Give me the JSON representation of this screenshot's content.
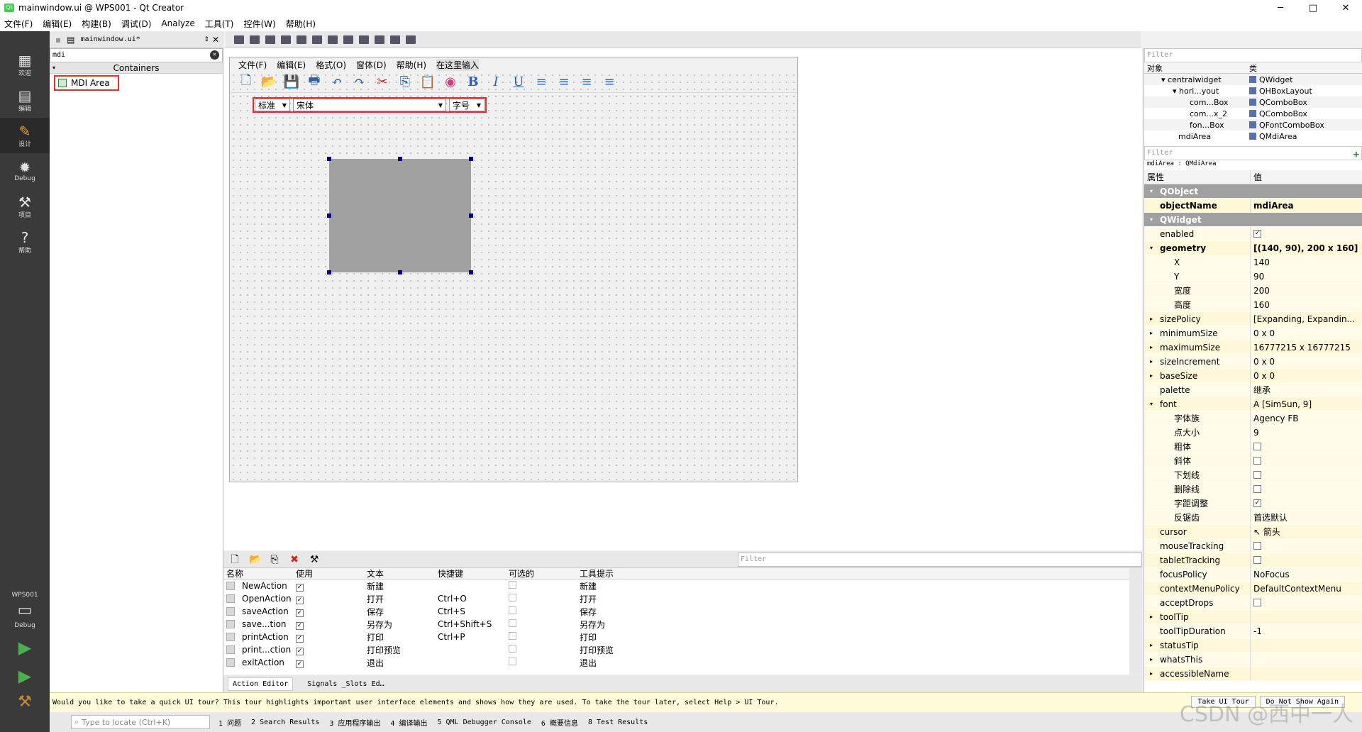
{
  "window": {
    "title": "mainwindow.ui @ WPS001 - Qt Creator",
    "icon": "qt-logo",
    "buttons": [
      "─",
      "□",
      "✕"
    ]
  },
  "menubar": [
    "文件(F)",
    "编辑(E)",
    "构建(B)",
    "调试(D)",
    "Analyze",
    "工具(T)",
    "控件(W)",
    "帮助(H)"
  ],
  "modes": [
    {
      "label": "欢迎",
      "icon": "grid-icon",
      "glyph": "▦"
    },
    {
      "label": "编辑",
      "icon": "edit-doc-icon",
      "glyph": "▤"
    },
    {
      "label": "设计",
      "icon": "pencil-icon",
      "glyph": "✎"
    },
    {
      "label": "Debug",
      "icon": "bug-icon",
      "glyph": "✹"
    },
    {
      "label": "项目",
      "icon": "wrench-icon",
      "glyph": "⚒"
    },
    {
      "label": "帮助",
      "icon": "help-icon",
      "glyph": "?"
    }
  ],
  "kit": {
    "name": "WPS001",
    "config": "Debug"
  },
  "editor": {
    "doc_name": "mainwindow.ui*"
  },
  "widgetbox": {
    "filter": "mdi",
    "category": "Containers",
    "item": "MDI Area"
  },
  "form": {
    "menu": [
      "文件(F)",
      "编辑(E)",
      "格式(O)",
      "窗体(D)",
      "帮助(H)",
      "在这里输入"
    ],
    "toolbar_glyphs": [
      "🗋",
      "📂",
      "💾",
      "🖶",
      "↶",
      "↷",
      "✂",
      "⎘",
      "📋",
      "◉",
      "B",
      "I",
      "U",
      "≡",
      "≡",
      "≡",
      "≡"
    ],
    "combos": [
      "标准",
      "宋体",
      "字号"
    ]
  },
  "actions": {
    "filter_placeholder": "Filter",
    "headers": [
      "名称",
      "使用",
      "文本",
      "快捷键",
      "可选的",
      "工具提示"
    ],
    "rows": [
      {
        "name": "NewAction",
        "used": "✓",
        "text": "新建",
        "shortcut": "",
        "tip": "新建"
      },
      {
        "name": "OpenAction",
        "used": "✓",
        "text": "打开",
        "shortcut": "Ctrl+O",
        "tip": "打开"
      },
      {
        "name": "saveAction",
        "used": "✓",
        "text": "保存",
        "shortcut": "Ctrl+S",
        "tip": "保存"
      },
      {
        "name": "save...tion",
        "used": "✓",
        "text": "另存为",
        "shortcut": "Ctrl+Shift+S",
        "tip": "另存为"
      },
      {
        "name": "printAction",
        "used": "✓",
        "text": "打印",
        "shortcut": "Ctrl+P",
        "tip": "打印"
      },
      {
        "name": "print...ction",
        "used": "✓",
        "text": "打印预览",
        "shortcut": "",
        "tip": "打印预览"
      },
      {
        "name": "exitAction",
        "used": "✓",
        "text": "退出",
        "shortcut": "",
        "tip": "退出"
      }
    ],
    "tabs": [
      "Action Editor",
      "Signals _Slots Ed…"
    ]
  },
  "objects": {
    "filter_placeholder": "Filter",
    "headers": [
      "对象",
      "类"
    ],
    "rows": [
      {
        "name": "centralwidget",
        "cls": "QWidget",
        "prefix": "▾ "
      },
      {
        "name": "hori...yout",
        "cls": "QHBoxLayout",
        "prefix": "▾ "
      },
      {
        "name": "com...Box",
        "cls": "QComboBox",
        "prefix": ""
      },
      {
        "name": "com...x_2",
        "cls": "QComboBox",
        "prefix": ""
      },
      {
        "name": "fon...Box",
        "cls": "QFontComboBox",
        "prefix": ""
      },
      {
        "name": "mdiArea",
        "cls": "QMdiArea",
        "prefix": ""
      }
    ]
  },
  "properties": {
    "filter_placeholder": "Filter",
    "class_line": "mdiArea : QMdiArea",
    "headers": [
      "属性",
      "值"
    ],
    "rows": [
      {
        "n": "QObject",
        "v": "",
        "t": "grp"
      },
      {
        "n": "objectName",
        "v": "mdiArea",
        "t": "y1 bold"
      },
      {
        "n": "QWidget",
        "v": "",
        "t": "grp"
      },
      {
        "n": "enabled",
        "v": "✓",
        "t": "y2"
      },
      {
        "n": "geometry",
        "v": "[(140, 90), 200 x 160]",
        "t": "y1 bold"
      },
      {
        "n": "X",
        "v": "140",
        "t": "y2 sub"
      },
      {
        "n": "Y",
        "v": "90",
        "t": "y2 sub"
      },
      {
        "n": "宽度",
        "v": "200",
        "t": "y2 sub"
      },
      {
        "n": "高度",
        "v": "160",
        "t": "y2 sub"
      },
      {
        "n": "sizePolicy",
        "v": "[Expanding, Expandin...",
        "t": "y1"
      },
      {
        "n": "minimumSize",
        "v": "0 x 0",
        "t": "y2"
      },
      {
        "n": "maximumSize",
        "v": "16777215 x 16777215",
        "t": "y1"
      },
      {
        "n": "sizeIncrement",
        "v": "0 x 0",
        "t": "y2"
      },
      {
        "n": "baseSize",
        "v": "0 x 0",
        "t": "y1"
      },
      {
        "n": "palette",
        "v": "继承",
        "t": "y2"
      },
      {
        "n": "font",
        "v": "A  [SimSun, 9]",
        "t": "y1"
      },
      {
        "n": "字体族",
        "v": "Agency FB",
        "t": "y2 sub"
      },
      {
        "n": "点大小",
        "v": "9",
        "t": "y2 sub"
      },
      {
        "n": "粗体",
        "v": "",
        "t": "y2 sub"
      },
      {
        "n": "斜体",
        "v": "",
        "t": "y2 sub"
      },
      {
        "n": "下划线",
        "v": "",
        "t": "y2 sub"
      },
      {
        "n": "删除线",
        "v": "",
        "t": "y2 sub"
      },
      {
        "n": "字距调整",
        "v": "✓",
        "t": "y2 sub"
      },
      {
        "n": "反锯齿",
        "v": "首选默认",
        "t": "y2 sub"
      },
      {
        "n": "cursor",
        "v": "↖ 箭头",
        "t": "y1"
      },
      {
        "n": "mouseTracking",
        "v": "",
        "t": "y2"
      },
      {
        "n": "tabletTracking",
        "v": "",
        "t": "y1"
      },
      {
        "n": "focusPolicy",
        "v": "NoFocus",
        "t": "y2"
      },
      {
        "n": "contextMenuPolicy",
        "v": "DefaultContextMenu",
        "t": "y1"
      },
      {
        "n": "acceptDrops",
        "v": "",
        "t": "y2"
      },
      {
        "n": "toolTip",
        "v": "",
        "t": "y1"
      },
      {
        "n": "toolTipDuration",
        "v": "-1",
        "t": "y2"
      },
      {
        "n": "statusTip",
        "v": "",
        "t": "y1"
      },
      {
        "n": "whatsThis",
        "v": "",
        "t": "y2"
      },
      {
        "n": "accessibleName",
        "v": "",
        "t": "y1"
      }
    ]
  },
  "tour": {
    "message": "Would you like to take a quick UI tour? This tour highlights important user interface elements and shows how they are used. To take the tour later, select Help > UI Tour.",
    "take_label": "Take UI Tour",
    "dismiss_label": "Do Not Show Again"
  },
  "statusbar": {
    "locator_placeholder": "Type to locate (Ctrl+K)",
    "tabs": [
      "1 问题",
      "2 Search Results",
      "3 应用程序输出",
      "4 编译输出",
      "5 QML Debugger Console",
      "6 概要信息",
      "8 Test Results"
    ]
  },
  "watermark": "CSDN @西中一人"
}
